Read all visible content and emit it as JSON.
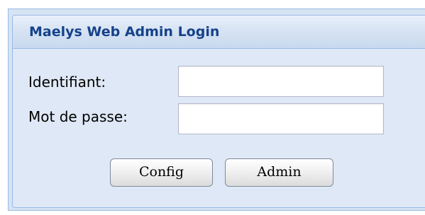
{
  "login_panel": {
    "title": "Maelys Web Admin Login",
    "username_label": "Identifiant:",
    "username_value": "",
    "password_label": "Mot de passe:",
    "password_value": "",
    "buttons": {
      "config_label": "Config",
      "admin_label": "Admin"
    }
  },
  "colors": {
    "title_text": "#15428b",
    "panel_border": "#99bbe8",
    "panel_background": "#dfe8f6"
  }
}
